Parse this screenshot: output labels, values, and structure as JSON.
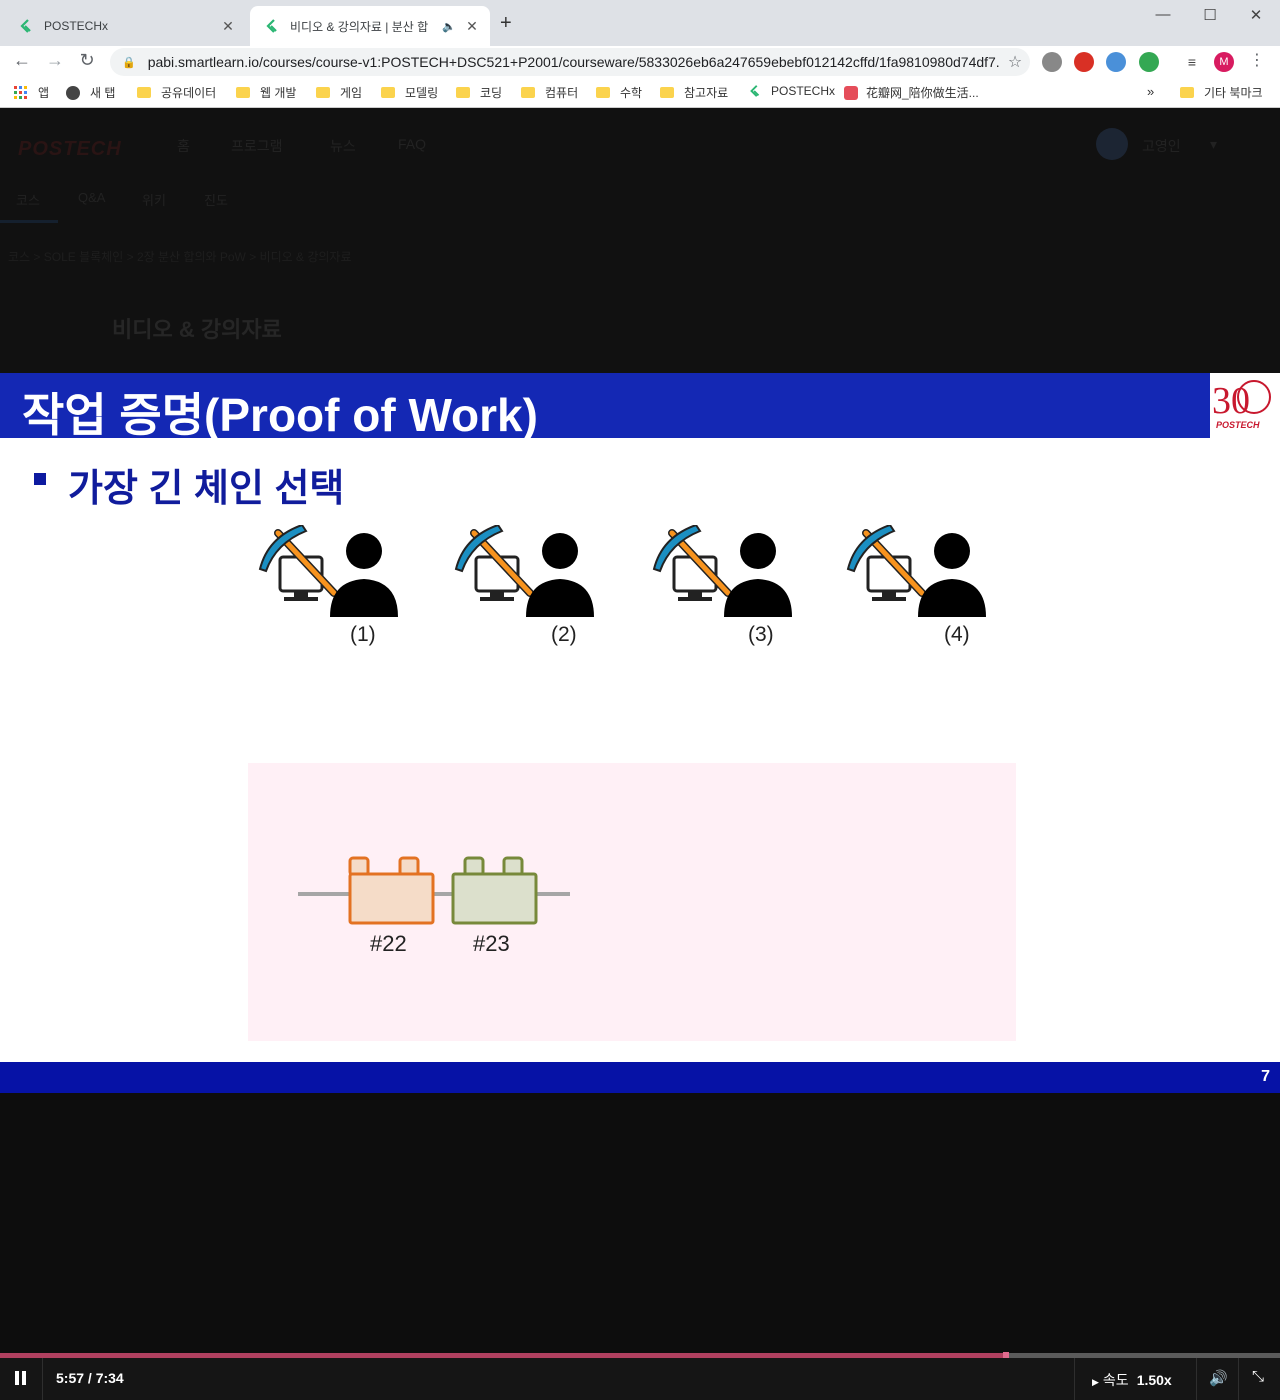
{
  "browser": {
    "tabs": [
      {
        "title": "POSTECHx",
        "close": "✕"
      },
      {
        "title": "비디오 & 강의자료 | 분산 합",
        "audio": "🔈",
        "close": "✕"
      }
    ],
    "new_tab": "+",
    "window_controls": {
      "minimize": "—",
      "maximize": "☐",
      "close": "✕"
    },
    "nav": {
      "back": "←",
      "forward": "→",
      "reload": "↻",
      "menu": "⋮"
    },
    "url": "pabi.smartlearn.io/courses/course-v1:POSTECH+DSC521+P2001/courseware/5833026eb6a247659ebebf012142cffd/1fa9810980d74df7...",
    "star": "☆",
    "profile_initial": "M",
    "bookmarks": [
      "앱",
      "새 탭",
      "공유데이터",
      "웹 개발",
      "게임",
      "모델링",
      "코딩",
      "컴퓨터",
      "수학",
      "참고자료",
      "POSTECHx",
      "花瓣网_陪你做生活...",
      "»",
      "기타 북마크"
    ]
  },
  "page": {
    "logo": "POSTECH",
    "nav": [
      "홈",
      "프로그램",
      "뉴스",
      "FAQ"
    ],
    "user_name": "고영인",
    "tabs": [
      "코스",
      "Q&A",
      "위키",
      "진도"
    ],
    "breadcrumb": "코스  >  SOLE 블록체인  >  2장 분산 합의와 PoW  >  비디오 & 강의자료",
    "heading": "비디오 & 강의자료"
  },
  "slide": {
    "title": "작업 증명(Proof of Work)",
    "subtitle": "가장 긴 체인 선택",
    "miners": [
      "(1)",
      "(2)",
      "(3)",
      "(4)"
    ],
    "blocks": [
      "#22",
      "#23"
    ],
    "page_number": "7",
    "logo_text": "POSTECH",
    "anniversary": "30",
    "colors": {
      "title_bar": "#1428b4",
      "footer_bar": "#0612a6",
      "subtitle": "#101c9c",
      "block_22": "#f5dcc8",
      "block_23": "#dce0cc",
      "chain_bg": "#fff0f6"
    }
  },
  "player": {
    "current_time": "5:57",
    "duration": "7:34",
    "time_display": "5:57 / 7:34",
    "progress": 0.786,
    "speed_label": "속도",
    "speed_value": "1.50x"
  }
}
